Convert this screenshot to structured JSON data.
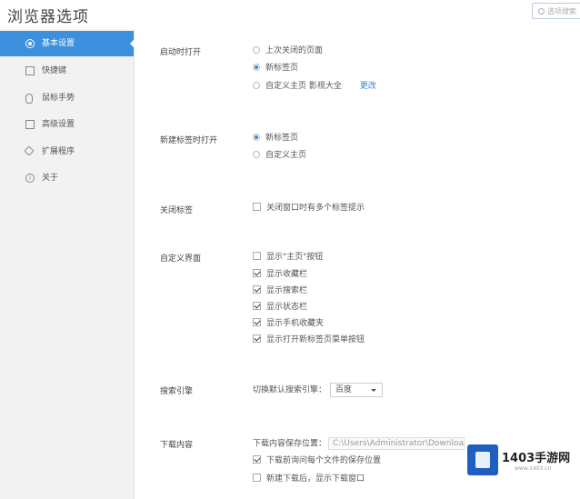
{
  "window": {
    "title": "浏览器选项"
  },
  "search": {
    "placeholder": "选项搜索"
  },
  "sidebar": {
    "items": [
      {
        "label": "基本设置",
        "icon": "gear-icon",
        "active": true
      },
      {
        "label": "快捷键",
        "icon": "flash-icon",
        "active": false
      },
      {
        "label": "鼠标手势",
        "icon": "mouse-icon",
        "active": false
      },
      {
        "label": "高级设置",
        "icon": "advanced-icon",
        "active": false
      },
      {
        "label": "扩展程序",
        "icon": "extension-icon",
        "active": false
      },
      {
        "label": "关于",
        "icon": "info-icon",
        "active": false
      }
    ]
  },
  "startup": {
    "label": "启动时打开",
    "options": [
      "上次关闭的页面",
      "新标签页",
      "自定义主页 影视大全"
    ],
    "selected_index": 1,
    "change_link": "更改"
  },
  "new_tab": {
    "label": "新建标签时打开",
    "options": [
      "新标签页",
      "自定义主页"
    ],
    "selected_index": 0
  },
  "close_tab": {
    "label": "关闭标签",
    "checkbox": "关闭窗口时有多个标签提示",
    "checked": false
  },
  "custom_ui": {
    "label": "自定义界面",
    "checkboxes": [
      {
        "text": "显示\"主页\"按钮",
        "checked": false
      },
      {
        "text": "显示收藏栏",
        "checked": true
      },
      {
        "text": "显示搜索栏",
        "checked": true
      },
      {
        "text": "显示状态栏",
        "checked": true
      },
      {
        "text": "显示手机收藏夹",
        "checked": true
      },
      {
        "text": "显示打开新标签页菜单按钮",
        "checked": true
      }
    ]
  },
  "search_engine": {
    "label": "搜索引擎",
    "prompt": "切换默认搜索引擎：",
    "selected": "百度"
  },
  "downloads": {
    "label": "下载内容",
    "path_label": "下载内容保存位置：",
    "path_value": "C:\\Users\\Administrator\\Downloads",
    "options": [
      {
        "text": "下载前询问每个文件的保存位置",
        "checked": true
      },
      {
        "text": "新建下载后，显示下载窗口",
        "checked": false
      }
    ]
  },
  "watermark": {
    "brand": "1403手游网",
    "url": "www.1403.cn"
  },
  "colors": {
    "accent": "#3d90dd",
    "link": "#3d7fd6",
    "sidebar_bg": "#f2f2f2",
    "watermark_blue": "#1f5fbf"
  }
}
